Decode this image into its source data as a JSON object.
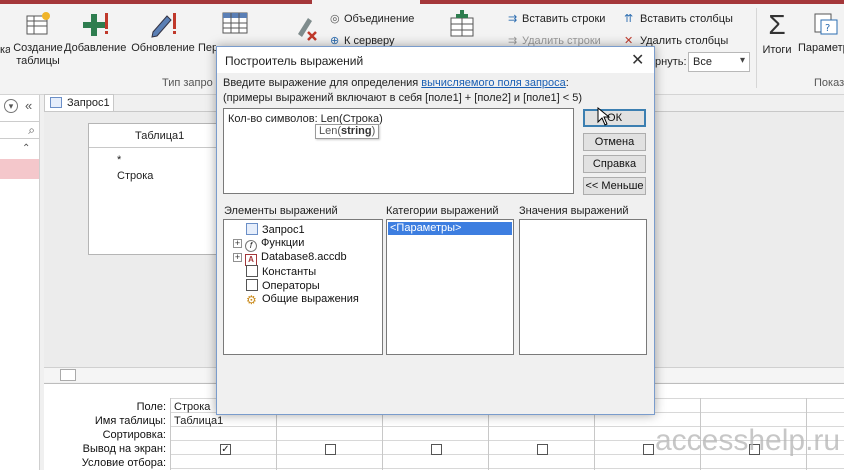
{
  "ribbon": {
    "btn_partial_left": "ка",
    "btn_create_table": "Создание\nтаблицы",
    "btn_add": "Добавление",
    "btn_update": "Обновление",
    "btn_partial_per": "Пер",
    "union": "Объединение",
    "to_server": "К серверу",
    "insert_rows": "Вставить строки",
    "delete_rows": "Удалить строки",
    "insert_cols": "Вставить столбцы",
    "delete_cols": "Удалить столбцы",
    "return_partial": "рнуть:",
    "return_value": "Все",
    "totals": "Итоги",
    "params_partial": "Параметр",
    "group_query_type": "Тип запро",
    "group_show_partial": "Показ",
    "colors": {
      "accent": "#a4373a"
    }
  },
  "query": {
    "tab_label": "Запрос1",
    "table_title": "Таблица1",
    "fields": [
      "*",
      "Строка"
    ]
  },
  "grid": {
    "labels": [
      "Поле:",
      "Имя таблицы:",
      "Сортировка:",
      "Вывод на экран:",
      "Условие отбора:"
    ],
    "col1_field": "Строка",
    "col1_table": "Таблица1"
  },
  "dialog": {
    "title": "Построитель выражений",
    "instruction_prefix": "Введите выражение для определения ",
    "instruction_link": "вычисляемого поля запроса",
    "instruction_suffix": ":",
    "examples": "(примеры выражений включают в себя [поле1] + [поле2] и [поле1] < 5)",
    "expression": "Кол-во символов: Len(Строка)",
    "tooltip_func": "Len(",
    "tooltip_arg": "string",
    "tooltip_close": ")",
    "buttons": {
      "ok": "ОК",
      "cancel": "Отмена",
      "help": "Справка",
      "less": "<< Меньше"
    },
    "col_elements": "Элементы выражений",
    "col_categories": "Категории выражений",
    "col_values": "Значения выражений",
    "tree": [
      "Запрос1",
      "Функции",
      "Database8.accdb",
      "Константы",
      "Операторы",
      "Общие выражения"
    ],
    "categories": [
      "<Параметры>"
    ]
  },
  "watermark": "accesshelp.ru"
}
